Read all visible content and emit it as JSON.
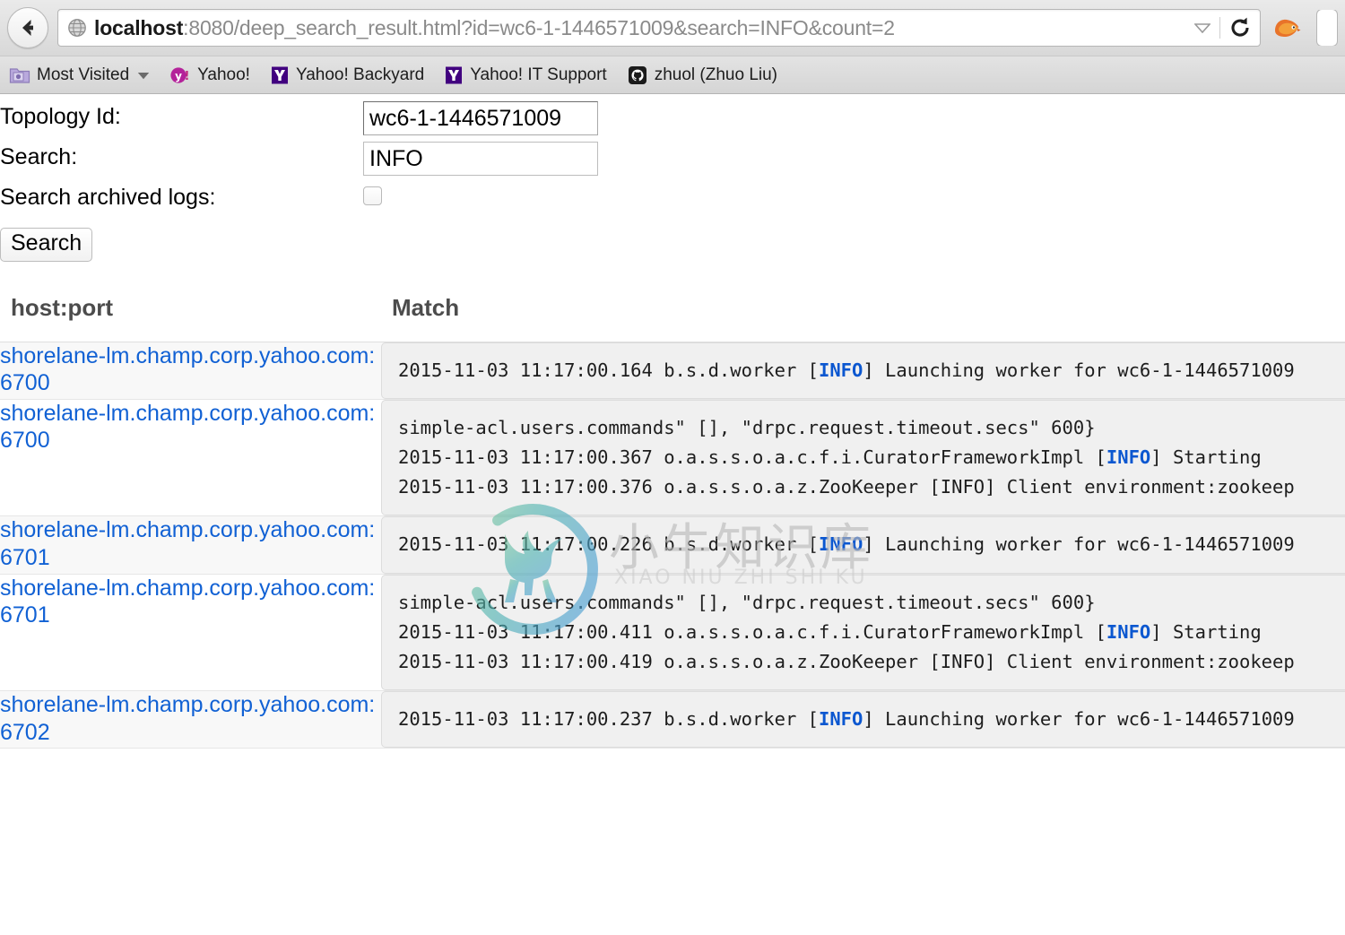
{
  "browser": {
    "back_icon": "back-arrow-icon",
    "globe_icon": "globe-icon",
    "url_host": "localhost",
    "url_rest": ":8080/deep_search_result.html?id=wc6-1-1446571009&search=INFO&count=2",
    "url_full": "localhost:8080/deep_search_result.html?id=wc6-1-1446571009&search=INFO&count=2",
    "dropdown_icon": "chevron-down-icon",
    "reload_icon": "reload-icon",
    "firefox_icon": "firefox-icon",
    "bookmarks": [
      {
        "label": "Most Visited",
        "icon": "folder-star-icon",
        "has_caret": true
      },
      {
        "label": "Yahoo!",
        "icon": "yahoo-circle-icon",
        "has_caret": false
      },
      {
        "label": "Yahoo! Backyard",
        "icon": "yahoo-y-icon",
        "has_caret": false
      },
      {
        "label": "Yahoo! IT Support",
        "icon": "yahoo-y-icon",
        "has_caret": false
      },
      {
        "label": "zhuol (Zhuo Liu)",
        "icon": "github-icon",
        "has_caret": false
      }
    ]
  },
  "form": {
    "topology_label": "Topology Id:",
    "topology_value": "wc6-1-1446571009",
    "topology_placeholder": "",
    "search_label": "Search:",
    "search_value": "INFO",
    "search_placeholder": "",
    "archived_label": "Search archived logs:",
    "archived_checked": false,
    "submit_label": "Search"
  },
  "table": {
    "headers": {
      "host": "host:port",
      "match": "Match"
    },
    "rows": [
      {
        "host": "shorelane-lm.champ.corp.yahoo.com:6700",
        "lines": [
          {
            "pre": "2015-11-03 11:17:00.164 b.s.d.worker [",
            "level": "INFO",
            "post": "] Launching worker for wc6-1-1446571009"
          }
        ]
      },
      {
        "host": "shorelane-lm.champ.corp.yahoo.com:6700",
        "lines": [
          {
            "pre": "simple-acl.users.commands\" [], \"drpc.request.timeout.secs\" 600}",
            "level": "",
            "post": ""
          },
          {
            "pre": "2015-11-03 11:17:00.367 o.a.s.s.o.a.c.f.i.CuratorFrameworkImpl [",
            "level": "INFO",
            "post": "] Starting"
          },
          {
            "pre": "2015-11-03 11:17:00.376 o.a.s.s.o.a.z.ZooKeeper [INFO] Client environment:zookeep",
            "level": "",
            "post": ""
          }
        ]
      },
      {
        "host": "shorelane-lm.champ.corp.yahoo.com:6701",
        "lines": [
          {
            "pre": "2015-11-03 11:17:00.226 b.s.d.worker [",
            "level": "INFO",
            "post": "] Launching worker for wc6-1-1446571009"
          }
        ]
      },
      {
        "host": "shorelane-lm.champ.corp.yahoo.com:6701",
        "lines": [
          {
            "pre": "simple-acl.users.commands\" [], \"drpc.request.timeout.secs\" 600}",
            "level": "",
            "post": ""
          },
          {
            "pre": "2015-11-03 11:17:00.411 o.a.s.s.o.a.c.f.i.CuratorFrameworkImpl [",
            "level": "INFO",
            "post": "] Starting"
          },
          {
            "pre": "2015-11-03 11:17:00.419 o.a.s.s.o.a.z.ZooKeeper [INFO] Client environment:zookeep",
            "level": "",
            "post": ""
          }
        ]
      },
      {
        "host": "shorelane-lm.champ.corp.yahoo.com:6702",
        "lines": [
          {
            "pre": "2015-11-03 11:17:00.237 b.s.d.worker [",
            "level": "INFO",
            "post": "] Launching worker for wc6-1-1446571009"
          }
        ]
      }
    ]
  },
  "watermark": {
    "text": "小牛知识库",
    "pinyin": "XIAO NIU ZHI SHI KU",
    "logo_icon": "bull-circle-logo-icon"
  },
  "colors": {
    "link": "#1161d4",
    "log_level": "#0b57d0",
    "header_text": "#4c4c4c",
    "row_alt_bg": "#f8f8f8",
    "code_bg": "#f0f0f0"
  }
}
